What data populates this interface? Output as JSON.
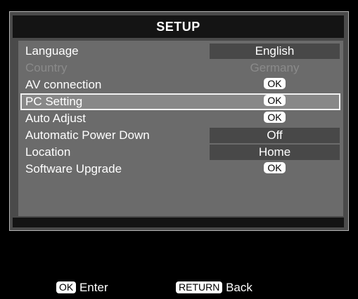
{
  "setup": {
    "title": "SETUP",
    "items": [
      {
        "label": "Language",
        "value": "English"
      },
      {
        "label": "Country",
        "value": "Germany"
      },
      {
        "label": "AV connection",
        "value": "OK"
      },
      {
        "label": "PC Setting",
        "value": "OK"
      },
      {
        "label": "Auto Adjust",
        "value": "OK"
      },
      {
        "label": "Automatic Power Down",
        "value": "Off"
      },
      {
        "label": "Location",
        "value": "Home"
      },
      {
        "label": "Software Upgrade",
        "value": "OK"
      }
    ]
  },
  "footer": {
    "enter_key": "OK",
    "enter_label": "Enter",
    "back_key": "RETURN",
    "back_label": "Back"
  },
  "colors": {
    "background": "#000000",
    "panel": "#6b6b6b",
    "selected_outline": "#f2f2f2",
    "disabled_text": "#8a8a8a"
  }
}
